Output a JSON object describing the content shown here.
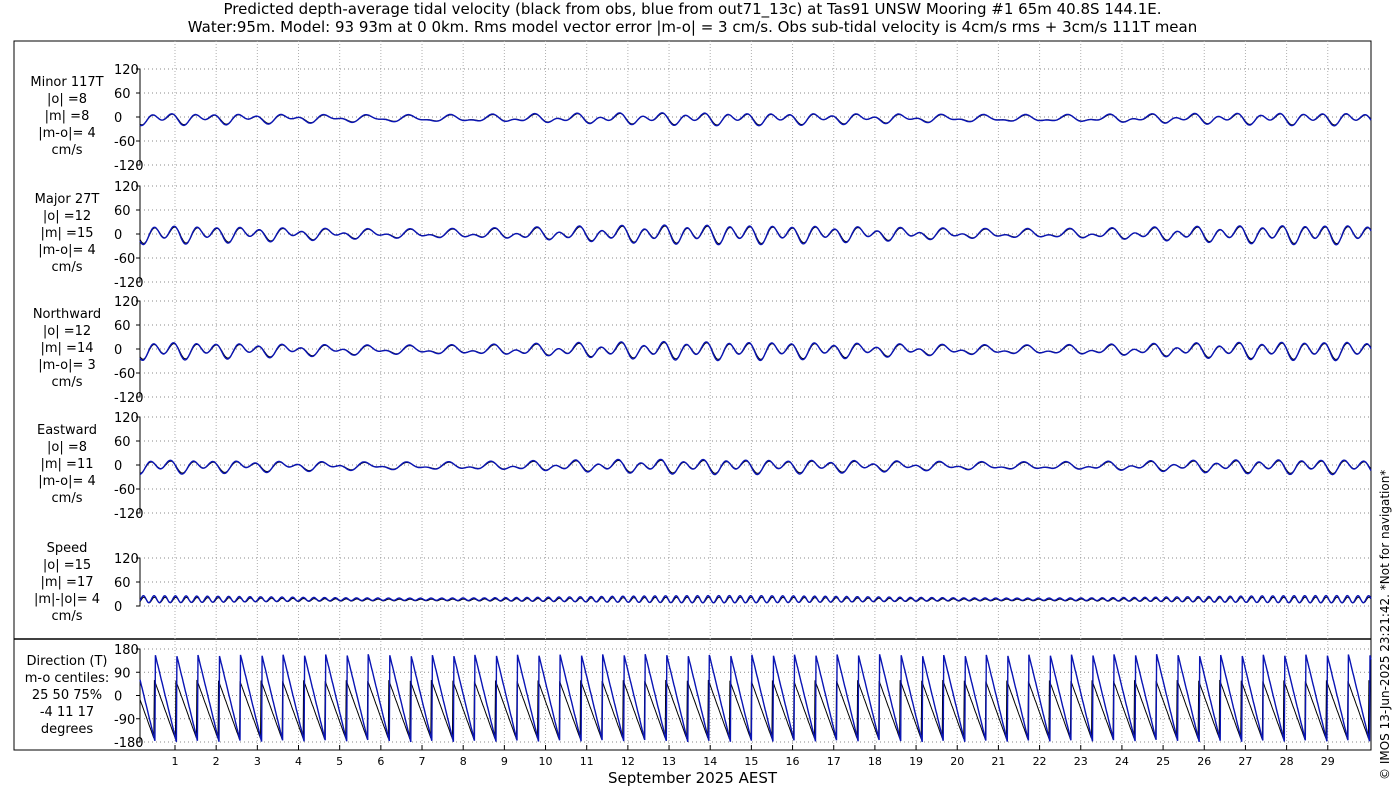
{
  "header": {
    "title_line1": "Predicted depth-average tidal velocity (black from obs, blue from out71_13c) at Tas91 UNSW Mooring #1 65m 40.8S 144.1E.",
    "title_line2": "Water:95m. Model: 93 93m at 0 0km. Rms model vector error |m-o| = 3 cm/s. Obs sub-tidal velocity is 4cm/s rms + 3cm/s 111T mean"
  },
  "panels": [
    {
      "id": "minor",
      "label_lines": [
        "Minor 117T",
        "|o| =8",
        "|m| =8",
        "|m-o|= 4",
        "cm/s"
      ]
    },
    {
      "id": "major",
      "label_lines": [
        "Major 27T",
        "|o| =12",
        "|m| =15",
        "|m-o|= 4",
        "cm/s"
      ]
    },
    {
      "id": "north",
      "label_lines": [
        "Northward",
        "|o| =12",
        "|m| =14",
        "|m-o|= 3",
        "cm/s"
      ]
    },
    {
      "id": "east",
      "label_lines": [
        "Eastward",
        "|o| =8",
        "|m| =11",
        "|m-o|= 4",
        "cm/s"
      ]
    },
    {
      "id": "speed",
      "label_lines": [
        "Speed",
        "|o| =15",
        "|m| =17",
        "|m|-|o|= 4",
        "cm/s"
      ]
    },
    {
      "id": "dir",
      "label_lines": [
        "Direction (T)",
        "m-o centiles:",
        "25  50  75%",
        "-4  11  17",
        "degrees"
      ]
    }
  ],
  "footer": {
    "xlabel": "September 2025 AEST",
    "credit": "© IMOS 13-Jun-2025 23:21:42. *Not for navigation*"
  },
  "chart_data": {
    "type": "line",
    "x_unit": "day of September 2025 (AEST)",
    "xlim": [
      0.15,
      30.05
    ],
    "x_ticks": [
      1,
      2,
      3,
      4,
      5,
      6,
      7,
      8,
      9,
      10,
      11,
      12,
      13,
      14,
      15,
      16,
      17,
      18,
      19,
      20,
      21,
      22,
      23,
      24,
      25,
      26,
      27,
      28,
      29
    ],
    "series_colors": {
      "obs": "#000000",
      "model": "#0a14b4"
    },
    "grid": true,
    "subplots": [
      {
        "id": "minor",
        "ylim": [
          -120,
          120
        ],
        "yticks": [
          -120,
          -60,
          0,
          60,
          120
        ],
        "obs_amplitude": [
          10,
          6
        ],
        "model_amplitude": [
          11,
          7
        ],
        "offset": -4
      },
      {
        "id": "major",
        "ylim": [
          -120,
          120
        ],
        "yticks": [
          -120,
          -60,
          0,
          60,
          120
        ],
        "obs_amplitude": [
          17,
          7
        ],
        "model_amplitude": [
          19,
          8
        ],
        "offset": 0
      },
      {
        "id": "north",
        "ylim": [
          -120,
          120
        ],
        "yticks": [
          -120,
          -60,
          0,
          60,
          120
        ],
        "obs_amplitude": [
          16,
          7
        ],
        "model_amplitude": [
          18,
          8
        ],
        "offset": -3
      },
      {
        "id": "east",
        "ylim": [
          -120,
          120
        ],
        "yticks": [
          -120,
          -60,
          0,
          60,
          120
        ],
        "obs_amplitude": [
          12,
          6
        ],
        "model_amplitude": [
          14,
          7
        ],
        "offset": -3
      },
      {
        "id": "speed",
        "ylim": [
          0,
          120
        ],
        "yticks": [
          0,
          60,
          120
        ],
        "obs_mean": 15,
        "model_mean": 17,
        "obs_amplitude": 7,
        "model_amplitude": 9
      },
      {
        "id": "dir",
        "ylim": [
          -180,
          180
        ],
        "yticks": [
          -180,
          -90,
          0,
          90,
          180
        ],
        "obs_start": 60,
        "model_start": 160,
        "obs_end": -170,
        "model_end": -180
      }
    ]
  }
}
